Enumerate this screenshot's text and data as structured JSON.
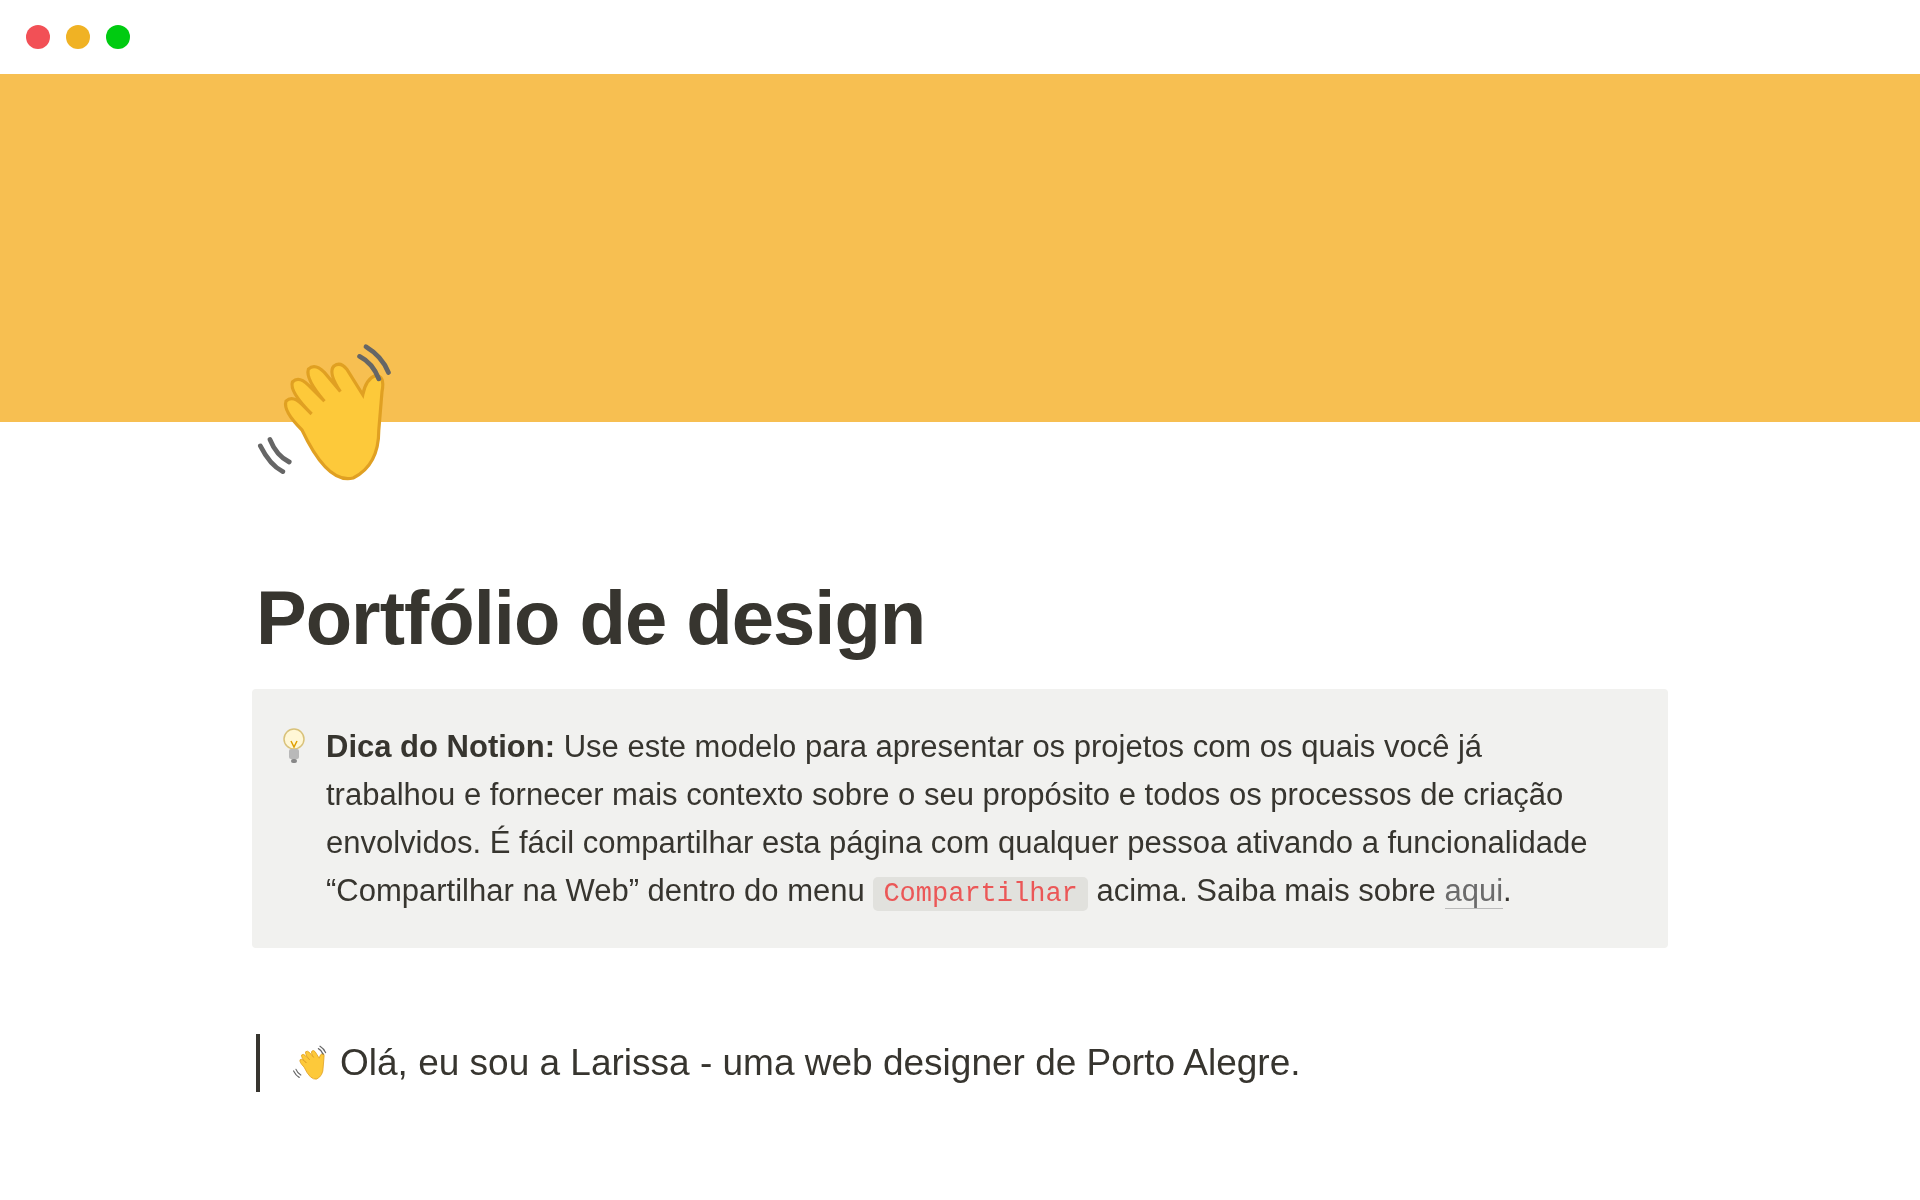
{
  "window": {
    "controls": [
      {
        "color": "#f25056"
      },
      {
        "color": "#f0b224"
      },
      {
        "color": "#00cb11"
      }
    ]
  },
  "cover": {
    "color": "#f7bf51"
  },
  "page": {
    "title": "Portfólio de design"
  },
  "callout": {
    "label": "Dica do Notion:",
    "text_before": "Use este modelo para apresentar os projetos com os quais você já trabalhou e fornecer mais contexto sobre o seu propósito e todos os processos de criação envolvidos. É fácil compartilhar esta página com qualquer pessoa ativando a funcionalidade “Compartilhar na Web” dentro do menu",
    "code": "Compartilhar",
    "text_after": "acima. Saiba mais sobre",
    "link": "aqui",
    "text_end": "."
  },
  "quote": {
    "text": "Olá, eu sou a Larissa - uma web designer de Porto Alegre."
  }
}
